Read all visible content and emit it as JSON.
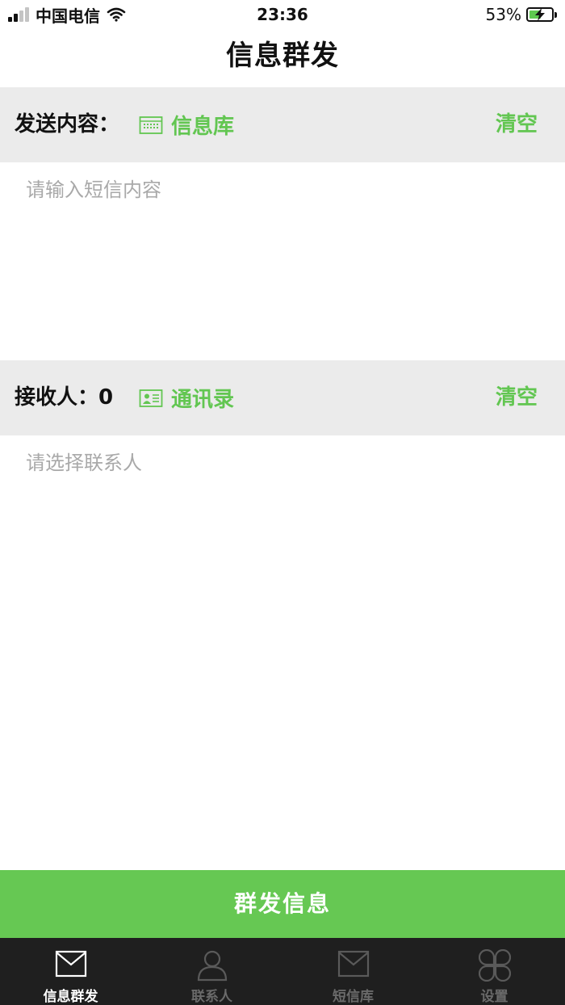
{
  "status_bar": {
    "carrier": "中国电信",
    "time": "23:36",
    "battery": "53%",
    "battery_level": 0.53
  },
  "nav": {
    "title": "信息群发"
  },
  "content_section": {
    "label": "发送内容：",
    "library_link": "信息库",
    "library_icon": "keyboard-icon",
    "clear_label": "清空",
    "placeholder": "请输入短信内容"
  },
  "recipient_section": {
    "label": "接收人：",
    "count": "0",
    "contacts_link": "通讯录",
    "contacts_icon": "contact-card-icon",
    "clear_label": "清空",
    "placeholder": "请选择联系人"
  },
  "send_button": {
    "label": "群发信息"
  },
  "tabbar": {
    "items": [
      {
        "label": "信息群发",
        "icon": "envelope-icon",
        "active": true
      },
      {
        "label": "联系人",
        "icon": "person-icon",
        "active": false
      },
      {
        "label": "短信库",
        "icon": "envelope-icon",
        "active": false
      },
      {
        "label": "设置",
        "icon": "clover-icon",
        "active": false
      }
    ]
  },
  "colors": {
    "accent": "#62c651",
    "button": "#66c853",
    "section_bg": "#ebebeb",
    "tabbar_bg": "#1f1f1f",
    "placeholder": "#a9a9a9"
  }
}
